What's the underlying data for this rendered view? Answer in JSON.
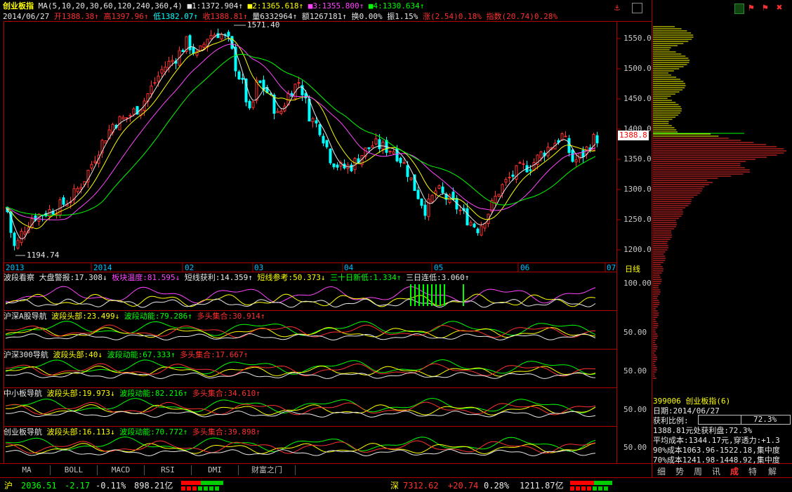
{
  "header": {
    "title": "创业板指",
    "ma_params": "MA(5,10,20,30,60,120,240,360,4)",
    "ma1": "■1:1372.904↑",
    "ma2": "■2:1365.618↑",
    "ma3": "■3:1355.800↑",
    "ma4": "■4:1330.634↑",
    "date": "2014/06/27",
    "open": "开1388.38↑",
    "high": "高1397.96↑",
    "low": "低1382.07↑",
    "close": "收1388.81↑",
    "volume": "量6332964↑",
    "amount": "额1267181↑",
    "turnover": "换0.00%",
    "amplitude": "振1.15%",
    "change": "涨(2.54)0.18%",
    "index_change": "指数(20.74)0.28%"
  },
  "chart": {
    "peak_label": "1571.40",
    "trough_label": "1194.74",
    "last_price": "1388.8",
    "y_ticks": [
      "1550.0",
      "1500.0",
      "1450.0",
      "1400.0",
      "1350.0",
      "1300.0",
      "1250.0",
      "1200.0"
    ],
    "x_ticks": [
      "2013",
      "2014",
      "02",
      "03",
      "04",
      "05",
      "06",
      "07"
    ],
    "period": "日线"
  },
  "panels": [
    {
      "name": "波段看察",
      "items": [
        {
          "label": "大盘警报:17.308↓",
          "color": "#e8e8e8"
        },
        {
          "label": "板块温度:81.595↓",
          "color": "#ff44ff"
        },
        {
          "label": "短线获利:14.359↑",
          "color": "#e8e8e8"
        },
        {
          "label": "短线参考:50.373↓",
          "color": "#ffff00"
        },
        {
          "label": "三十日新低:1.334↑",
          "color": "#00ff00"
        },
        {
          "label": "三日连低:3.060↑",
          "color": "#e8e8e8"
        }
      ],
      "tick": "100.00"
    },
    {
      "name": "沪深A股导航",
      "items": [
        {
          "label": "波段头部:23.499↓",
          "color": "#ffff00"
        },
        {
          "label": "波段动能:79.286↑",
          "color": "#00ff00"
        },
        {
          "label": "多头集合:30.914↑",
          "color": "#ff3030"
        }
      ],
      "tick": "50.00"
    },
    {
      "name": "沪深300导航",
      "items": [
        {
          "label": "波段头部:40↓",
          "color": "#ffff00"
        },
        {
          "label": "波段动能:67.333↑",
          "color": "#00ff00"
        },
        {
          "label": "多头集合:17.667↑",
          "color": "#ff3030"
        }
      ],
      "tick": "50.00"
    },
    {
      "name": "中小板导航",
      "items": [
        {
          "label": "波段头部:19.973↓",
          "color": "#ffff00"
        },
        {
          "label": "波段动能:82.216↑",
          "color": "#00ff00"
        },
        {
          "label": "多头集合:34.610↑",
          "color": "#ff3030"
        }
      ],
      "tick": "50.00"
    },
    {
      "name": "创业板导航",
      "items": [
        {
          "label": "波段头部:16.113↓",
          "color": "#ffff00"
        },
        {
          "label": "波段动能:70.772↑",
          "color": "#00ff00"
        },
        {
          "label": "多头集合:39.898↑",
          "color": "#ff3030"
        }
      ],
      "tick": "50.00"
    }
  ],
  "tabs": [
    "MA",
    "BOLL",
    "MACD",
    "RSI",
    "DMI",
    "财富之门"
  ],
  "info": {
    "code": "399006 创业板指(6)",
    "date": "日期:2014/06/27",
    "profit_ratio_label": "获利比例:",
    "profit_ratio": "72.3%",
    "profit_line": "1388.81元处获利盘:72.3%",
    "avg_cost": "平均成本:1344.17元,穿透力:+1.3",
    "cost90": "90%成本1063.96-1522.18,集中度",
    "cost70": "70%成本1241.98-1448.92,集中度"
  },
  "right_tabs": [
    "细",
    "势",
    "周",
    "讯",
    "成",
    "特",
    "解"
  ],
  "status": {
    "sh_label": "沪",
    "sh_price": "2036.51",
    "sh_change": "-2.17",
    "sh_pct": "-0.11%",
    "sh_amount": "898.21亿",
    "sz_label": "深",
    "sz_price": "7312.62",
    "sz_change": "+20.74",
    "sz_pct": "0.28%",
    "sz_amount": "1211.87亿"
  }
}
